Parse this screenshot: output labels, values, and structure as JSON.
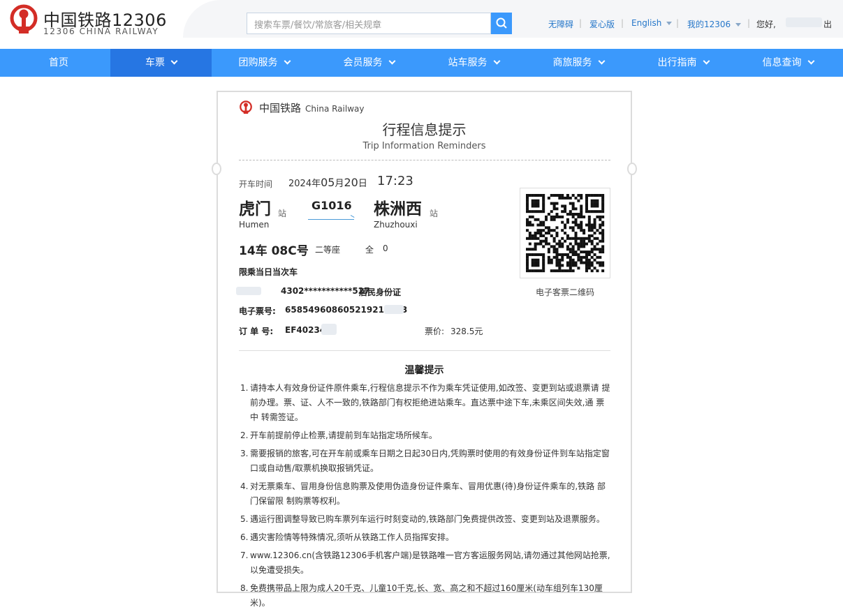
{
  "header": {
    "brand_cn": "中国铁路12306",
    "brand_en": "12306 CHINA RAILWAY",
    "search_placeholder": "搜索车票/餐饮/常旅客/相关规章",
    "links": [
      "无障碍",
      "爱心版",
      "English",
      "我的12306"
    ],
    "greeting": "您好,",
    "logout": "出"
  },
  "nav": {
    "items": [
      {
        "label": "首页",
        "dropdown": false,
        "active": false
      },
      {
        "label": "车票",
        "dropdown": true,
        "active": true
      },
      {
        "label": "团购服务",
        "dropdown": true,
        "active": false
      },
      {
        "label": "会员服务",
        "dropdown": true,
        "active": false
      },
      {
        "label": "站车服务",
        "dropdown": true,
        "active": false
      },
      {
        "label": "商旅服务",
        "dropdown": true,
        "active": false
      },
      {
        "label": "出行指南",
        "dropdown": true,
        "active": false
      },
      {
        "label": "信息查询",
        "dropdown": true,
        "active": false
      }
    ]
  },
  "ticket": {
    "brand_cn": "中国铁路",
    "brand_en": "China Railway",
    "title": "行程信息提示",
    "subtitle": "Trip Information Reminders",
    "depart_label": "开车时间",
    "date_year": "2024年",
    "date_month": "05",
    "date_month_suffix": "月",
    "date_day": "20",
    "date_day_suffix": "日",
    "time": "17:23",
    "from_station": "虎门",
    "from_pinyin": "Humen",
    "to_station": "株洲西",
    "to_pinyin": "Zhuzhouxi",
    "station_suffix": "站",
    "train_no": "G1016",
    "seat": "14车 08C号",
    "seat_class": "二等座",
    "fare_type": "全",
    "fare_type_value": "0",
    "restriction": "限乘当日当次车",
    "id_number": "4302***********527",
    "id_type": "居民身份证",
    "eticket_label": "电子票号:",
    "eticket_no": "658549608605219213943",
    "order_label": "订 单 号:",
    "order_no": "EF40234",
    "price_label": "票价:",
    "price": "328.5元",
    "qr_caption": "电子客票二维码"
  },
  "tips": {
    "title": "温馨提示",
    "items": [
      "请持本人有效身份证件原件乘车,行程信息提示不作为乘车凭证使用,如改签、变更到站或退票请 提 前办理。票、证、人不一致的,铁路部门有权拒绝进站乘车。直达票中途下车,未乘区间失效,通 票中 转需签证。",
      "开车前提前停止检票,请提前到车站指定场所候车。",
      "需要报销的旅客,可在开车前或乘车日期之日起30日内,凭购票时使用的有效身份证件到车站指定窗 口或自动售/取票机换取报销凭证。",
      "对无票乘车、冒用身份信息购票及使用伪造身份证件乘车、冒用优惠(待)身份证件乘车的,铁路 部门保留限 制购票等权利。",
      "遇运行图调整导致已购车票列车运行时刻变动的,铁路部门免费提供改签、变更到站及退票服务。",
      "遇灾害险情等特殊情况,须听从铁路工作人员指挥安排。",
      "www.12306.cn(含铁路12306手机客户端)是铁路唯一官方客运服务网站,请勿通过其他网站抢票,以免遭受损失。",
      "免费携带品上限为成人20千克、儿童10千克,长、宽、高之和不超过160厘米(动车组列车130厘米)。"
    ]
  },
  "colors": {
    "accent": "#3b99fc",
    "nav_active": "#2676e3",
    "brand_red": "#d32d26",
    "link": "#2677c9"
  }
}
